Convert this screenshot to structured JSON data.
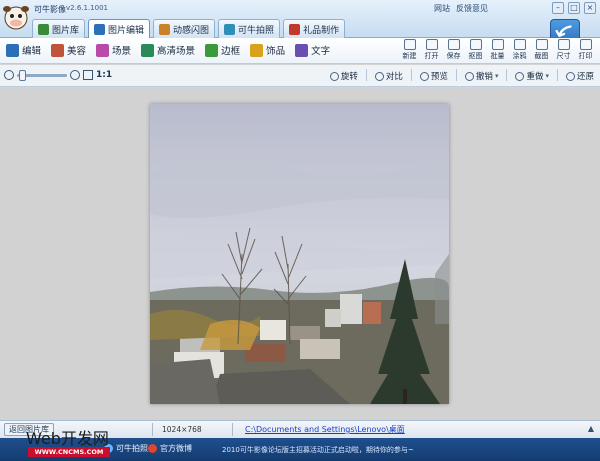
{
  "app": {
    "name": "可牛影像",
    "version": "v2.6.1.1001",
    "title_links": [
      "网站",
      "反馈意见"
    ],
    "window_controls": [
      "min-icon",
      "max-icon",
      "close-icon"
    ]
  },
  "tabs": [
    {
      "label": "图片库",
      "icon": "gallery-icon",
      "color": "#3a8a3a",
      "active": false
    },
    {
      "label": "图片编辑",
      "icon": "edit-photo-icon",
      "color": "#2f6fb8",
      "active": true
    },
    {
      "label": "动感闪图",
      "icon": "flash-image-icon",
      "color": "#c9822a",
      "active": false
    },
    {
      "label": "可牛拍照",
      "icon": "camera-icon",
      "color": "#2f8fb8",
      "active": false
    },
    {
      "label": "礼品制作",
      "icon": "gift-icon",
      "color": "#c0392b",
      "active": false
    }
  ],
  "tools_left": [
    {
      "label": "编辑",
      "icon": "edit-icon",
      "color": "#2d6fb6"
    },
    {
      "label": "美容",
      "icon": "beauty-icon",
      "color": "#c0533b"
    },
    {
      "label": "场景",
      "icon": "scene-icon",
      "color": "#b94ba8"
    },
    {
      "label": "高清场景",
      "icon": "hd-scene-icon",
      "color": "#2a8a5a"
    },
    {
      "label": "边框",
      "icon": "frame-icon",
      "color": "#3b9b3b"
    },
    {
      "label": "饰品",
      "icon": "decoration-icon",
      "color": "#d9a21e"
    },
    {
      "label": "文字",
      "icon": "text-icon",
      "color": "#6a4fb0"
    }
  ],
  "tools_right": [
    {
      "label": "新建",
      "icon": "new-icon"
    },
    {
      "label": "打开",
      "icon": "open-icon"
    },
    {
      "label": "保存",
      "icon": "save-icon"
    },
    {
      "label": "抠图",
      "icon": "cutout-icon"
    },
    {
      "label": "批量",
      "icon": "batch-icon"
    },
    {
      "label": "涂鸦",
      "icon": "doodle-icon"
    },
    {
      "label": "截图",
      "icon": "screenshot-icon"
    },
    {
      "label": "尺寸",
      "icon": "resize-icon"
    },
    {
      "label": "打印",
      "icon": "print-icon"
    }
  ],
  "zoom": {
    "ratio_label": "1:1",
    "level": 0.05
  },
  "edit_actions": [
    {
      "label": "旋转",
      "icon": "rotate-icon",
      "dropdown": false
    },
    {
      "label": "对比",
      "icon": "compare-icon",
      "dropdown": false
    },
    {
      "label": "预览",
      "icon": "preview-icon",
      "dropdown": false
    },
    {
      "label": "撤销",
      "icon": "undo-icon",
      "dropdown": true
    },
    {
      "label": "重做",
      "icon": "redo-icon",
      "dropdown": true
    },
    {
      "label": "还原",
      "icon": "restore-icon",
      "dropdown": false
    }
  ],
  "status": {
    "back_label": "返回图片库",
    "dimensions": "1024×768",
    "file_path": "C:\\Documents and Settings\\Lenovo\\桌面"
  },
  "bottom": {
    "camera_label": "可牛拍照",
    "weibo_label": "官方微博",
    "notice": "2010可牛影像论坛版主招募活动正式启动啦，期待你的参与~"
  },
  "watermark": {
    "main": "Web开发网",
    "sub": "WWW.CNCMS.COM"
  },
  "colors": {
    "accent": "#2f6fb8",
    "bottom_bar": "#1f4f8e",
    "link": "#1a3fc7"
  }
}
